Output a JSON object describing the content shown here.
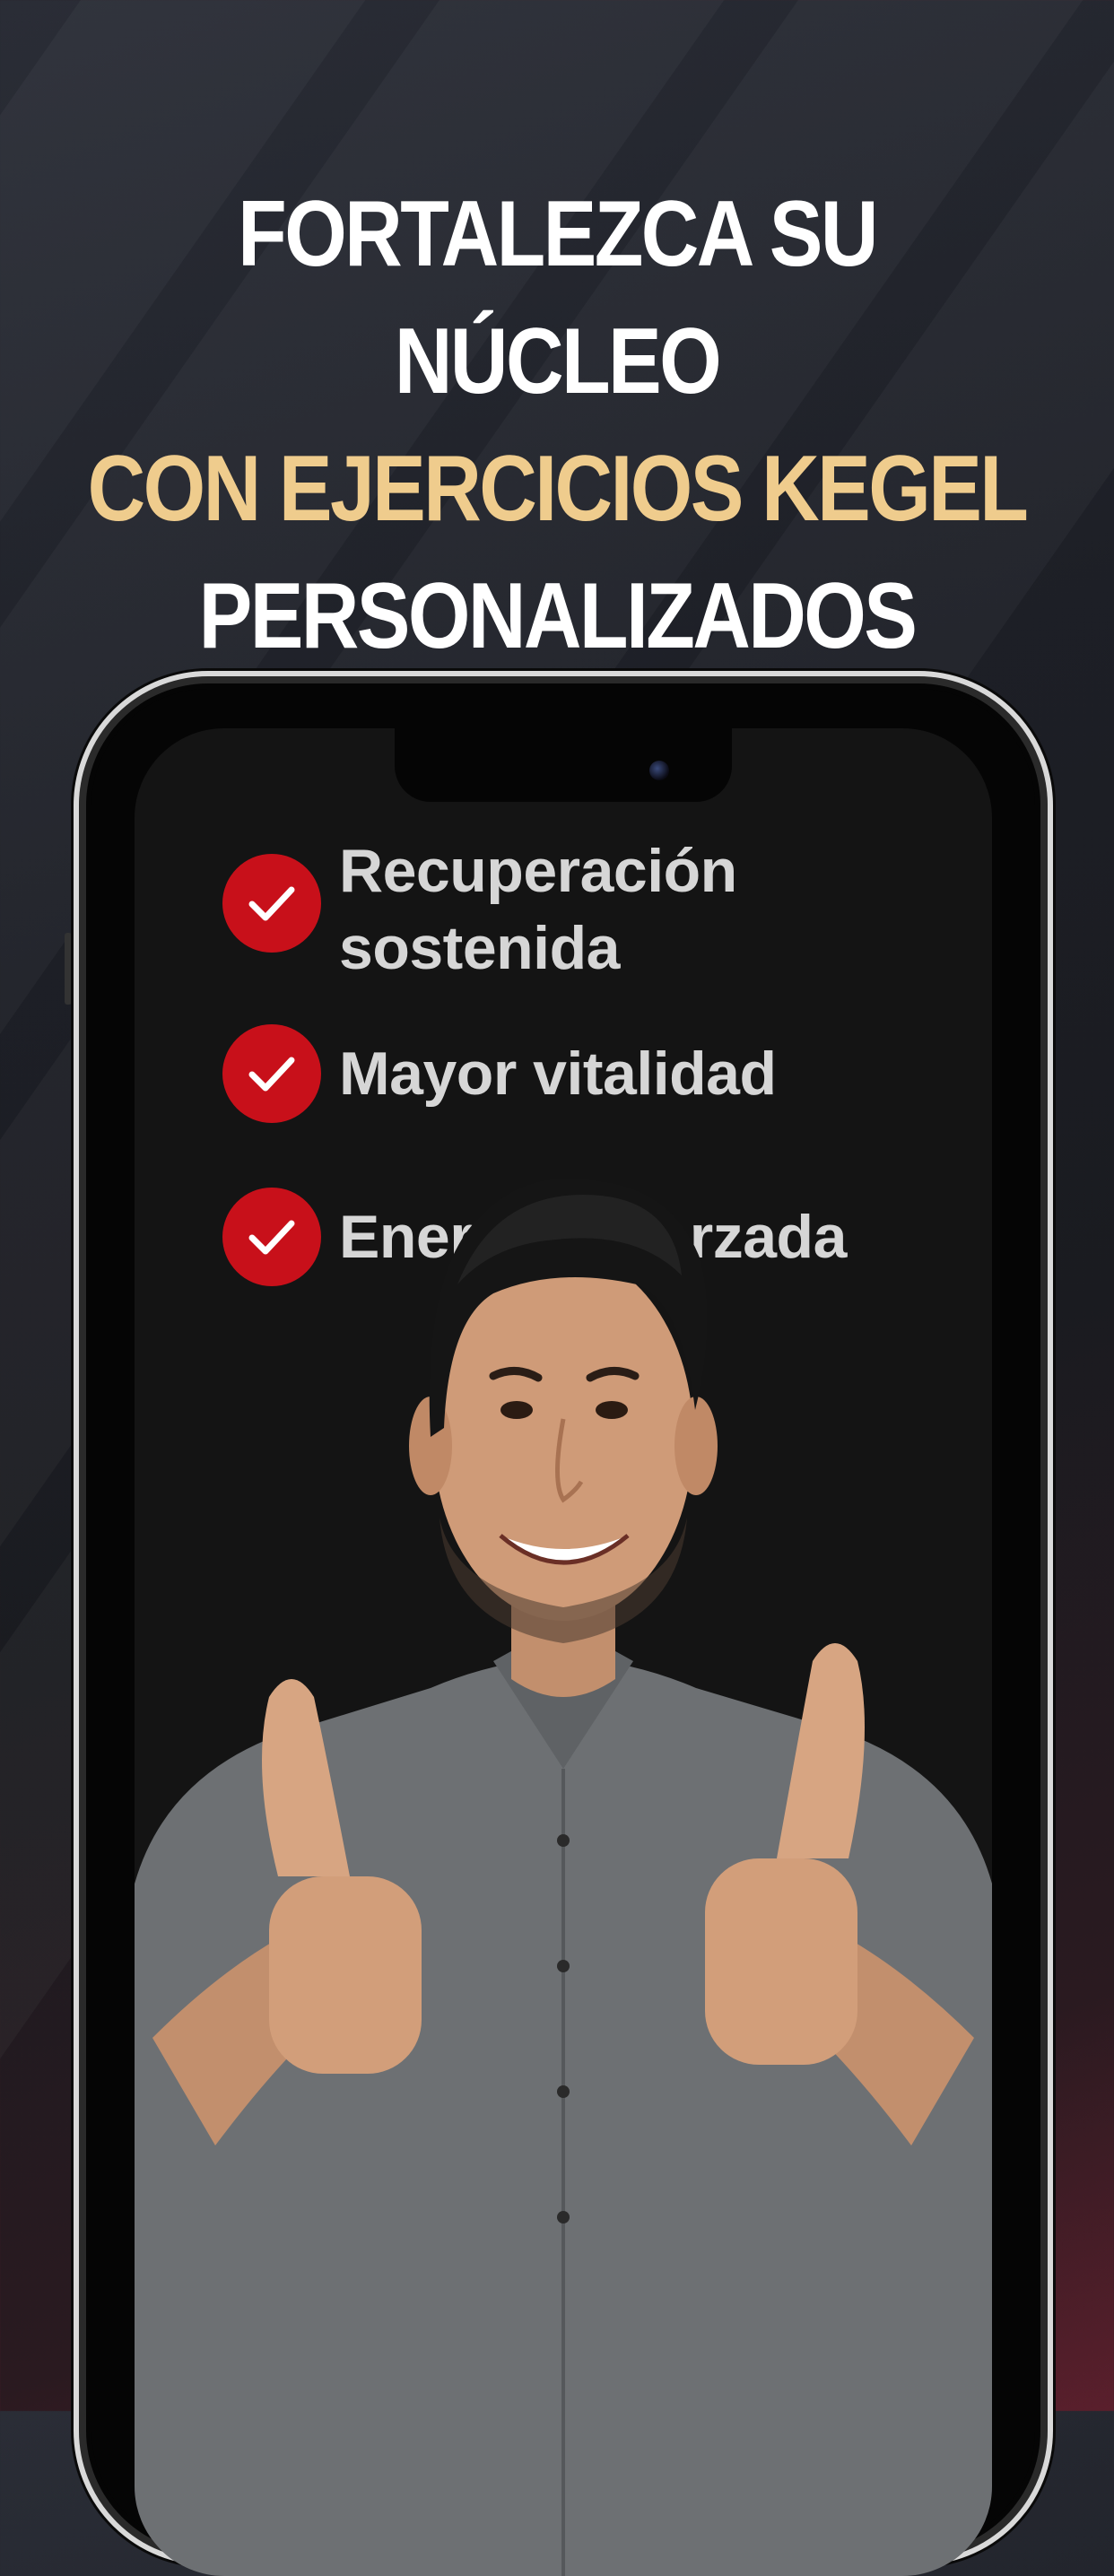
{
  "headline": {
    "line1": "FORTALEZCA SU NÚCLEO",
    "line2": "CON EJERCICIOS KEGEL",
    "line3": "PERSONALIZADOS",
    "colors": {
      "white": "#ffffff",
      "accent": "#efcc8d"
    }
  },
  "features": [
    {
      "label_line1": "Recuperación",
      "label_line2": "sostenida",
      "icon": "check-icon"
    },
    {
      "label": "Mayor vitalidad",
      "icon": "check-icon"
    },
    {
      "label": "Energía reforzada",
      "icon": "check-icon"
    }
  ],
  "colors": {
    "check_bg": "#c8101a",
    "screen_bg": "#141414",
    "shirt": "#6d7073"
  },
  "image": {
    "subject": "smiling-man-thumbs-up"
  }
}
